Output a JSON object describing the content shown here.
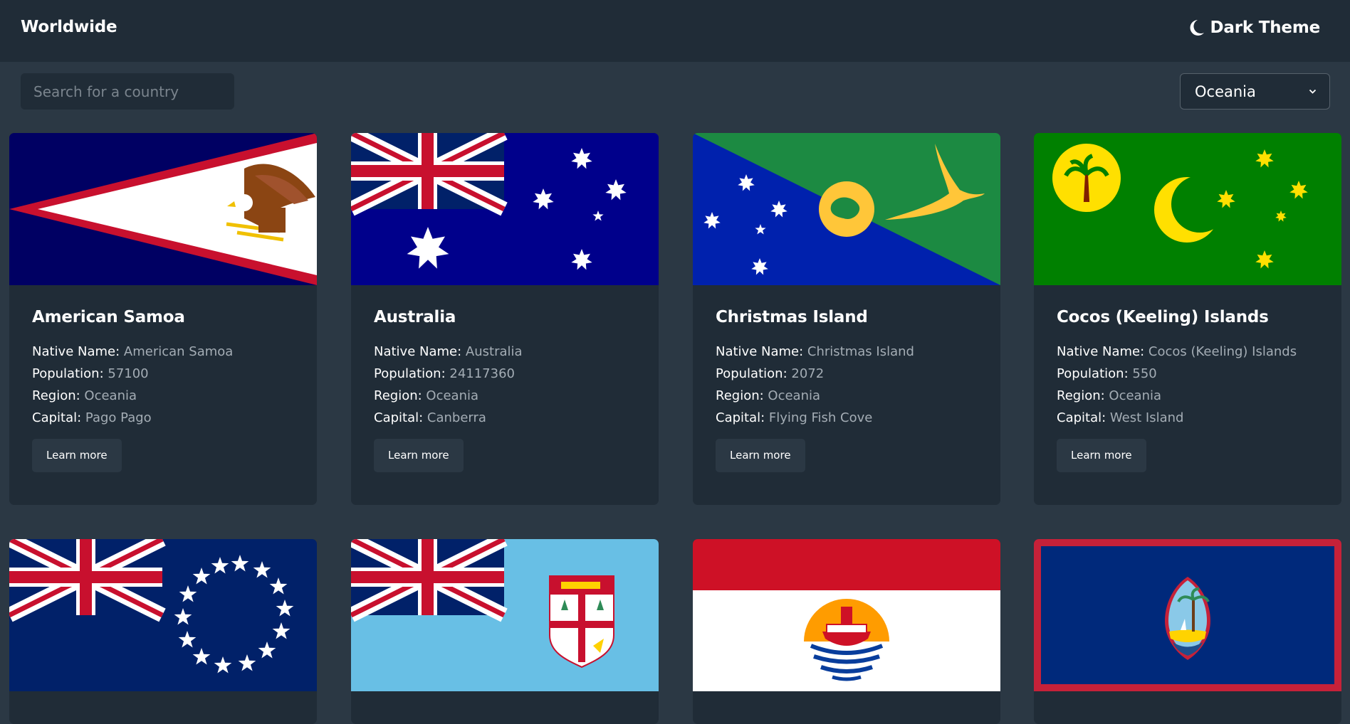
{
  "header": {
    "title": "Worldwide",
    "theme_label": "Dark Theme",
    "theme_icon": "moon-icon"
  },
  "controls": {
    "search_placeholder": "Search for a country",
    "region_selected": "Oceania"
  },
  "labels": {
    "native_name": "Native Name:",
    "population": "Population:",
    "region": "Region:",
    "capital": "Capital:",
    "learn_more": "Learn more"
  },
  "countries": [
    {
      "name": "American Samoa",
      "native_name": "American Samoa",
      "population": "57100",
      "region": "Oceania",
      "capital": "Pago Pago",
      "flag": "american-samoa-flag"
    },
    {
      "name": "Australia",
      "native_name": "Australia",
      "population": "24117360",
      "region": "Oceania",
      "capital": "Canberra",
      "flag": "australia-flag"
    },
    {
      "name": "Christmas Island",
      "native_name": "Christmas Island",
      "population": "2072",
      "region": "Oceania",
      "capital": "Flying Fish Cove",
      "flag": "christmas-island-flag"
    },
    {
      "name": "Cocos (Keeling) Islands",
      "native_name": "Cocos (Keeling) Islands",
      "population": "550",
      "region": "Oceania",
      "capital": "West Island",
      "flag": "cocos-islands-flag"
    },
    {
      "flag": "cook-islands-flag"
    },
    {
      "flag": "fiji-flag"
    },
    {
      "flag": "french-polynesia-flag"
    },
    {
      "flag": "guam-flag"
    }
  ],
  "colors": {
    "background": "#2b3844",
    "surface": "#202c37",
    "text": "#ffffff",
    "muted_text": "#a4adb5"
  }
}
